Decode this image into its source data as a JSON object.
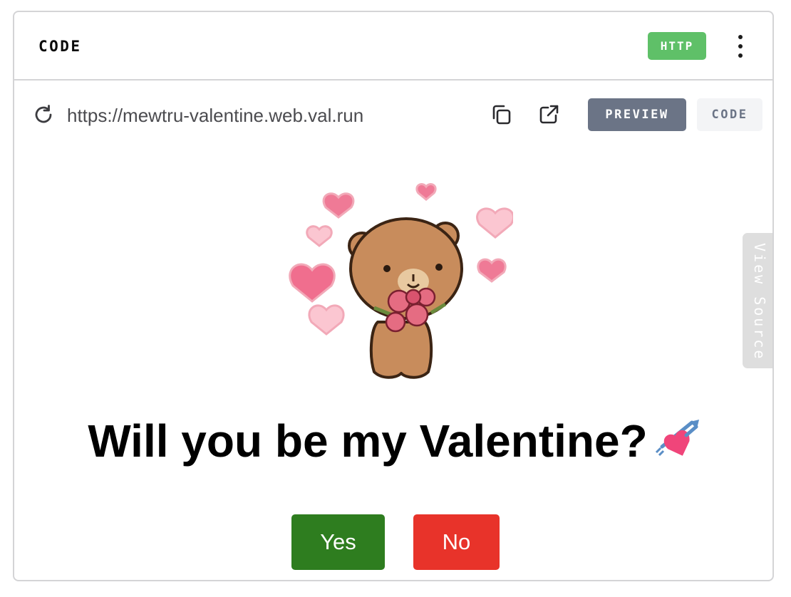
{
  "header": {
    "title": "CODE",
    "badge": "HTTP",
    "badge_color": "#5fc068",
    "menu_icon": "kebab-menu-icon"
  },
  "toolbar": {
    "refresh_icon": "refresh-icon",
    "url": "https://mewtru-valentine.web.val.run",
    "copy_icon": "copy-icon",
    "external_icon": "external-link-icon",
    "tabs": [
      {
        "label": "PREVIEW",
        "active": true
      },
      {
        "label": "CODE",
        "active": false
      }
    ]
  },
  "side_tab": {
    "label": "View Source"
  },
  "preview": {
    "image": "bear-holding-roses-with-hearts",
    "question": "Will you be my Valentine?",
    "emoji": "heart-with-arrow-emoji",
    "yes_label": "Yes",
    "no_label": "No",
    "yes_color": "#2e7d1f",
    "no_color": "#e8332a"
  }
}
